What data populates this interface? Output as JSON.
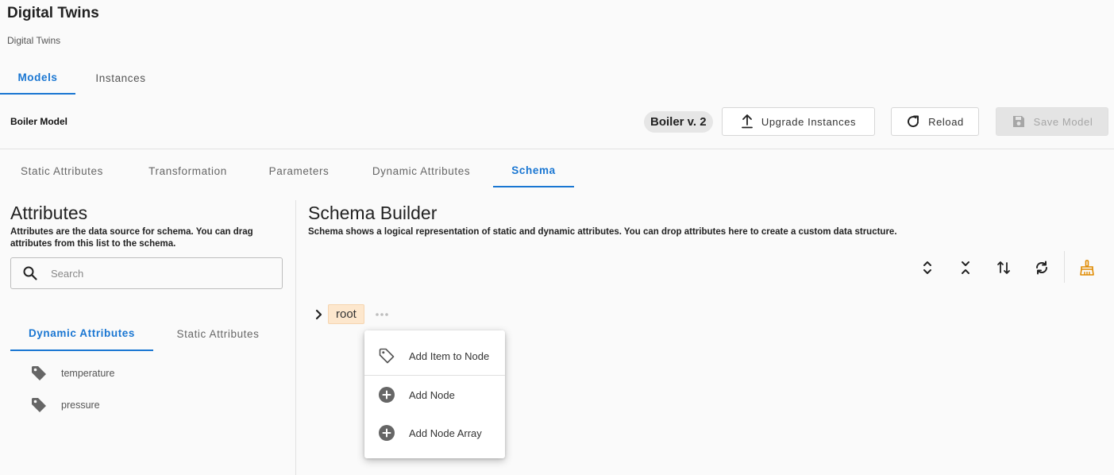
{
  "app": {
    "title": "Digital Twins",
    "subtitle": "Digital Twins"
  },
  "top_tabs": [
    {
      "label": "Models",
      "active": true
    },
    {
      "label": "Instances",
      "active": false
    }
  ],
  "model_bar": {
    "name": "Boiler Model",
    "version": "Boiler v. 2",
    "upgrade_label": "Upgrade Instances",
    "reload_label": "Reload",
    "save_label": "Save Model",
    "save_disabled": true
  },
  "sub_tabs": [
    {
      "label": "Static Attributes",
      "active": false
    },
    {
      "label": "Transformation",
      "active": false
    },
    {
      "label": "Parameters",
      "active": false
    },
    {
      "label": "Dynamic Attributes",
      "active": false
    },
    {
      "label": "Schema",
      "active": true
    }
  ],
  "attributes_panel": {
    "title": "Attributes",
    "description": "Attributes are the data source for schema. You can drag attributes from this list to the schema.",
    "search_placeholder": "Search",
    "tabs": [
      {
        "label": "Dynamic Attributes",
        "active": true
      },
      {
        "label": "Static Attributes",
        "active": false
      }
    ],
    "items": [
      {
        "label": "temperature",
        "icon": "tag-icon"
      },
      {
        "label": "pressure",
        "icon": "tag-icon"
      }
    ]
  },
  "schema_panel": {
    "title": "Schema Builder",
    "description": "Schema shows a logical representation of static and dynamic attributes. You can drop attributes here to create a custom data structure.",
    "toolbar": [
      "expand-all-icon",
      "collapse-all-icon",
      "sort-icon",
      "refresh-icon",
      "clear-schema-icon"
    ],
    "root_label": "root",
    "context_menu": [
      {
        "label": "Add Item to Node",
        "icon": "tag-outline-icon"
      },
      {
        "label": "Add Node",
        "icon": "add-circle-icon"
      },
      {
        "label": "Add Node Array",
        "icon": "add-circle-icon"
      }
    ]
  },
  "colors": {
    "accent": "#1976d2",
    "root_chip_bg": "#fde7cd",
    "clear_icon": "#e08a00"
  }
}
